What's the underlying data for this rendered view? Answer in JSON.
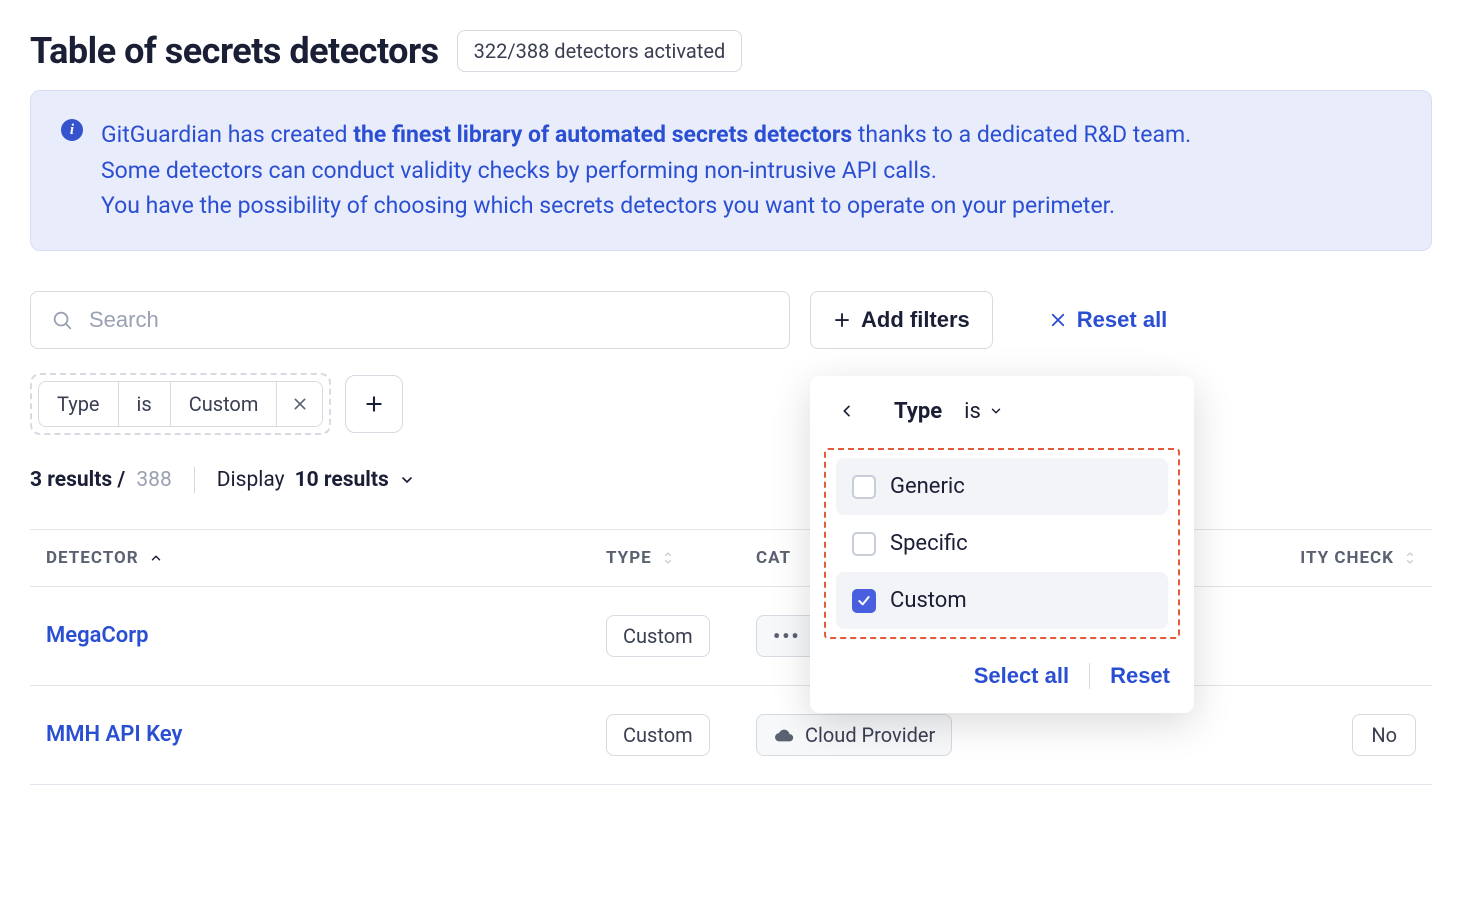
{
  "header": {
    "title": "Table of secrets detectors",
    "badge": "322/388 detectors activated"
  },
  "banner": {
    "line1_pre": "GitGuardian has created ",
    "line1_bold": "the finest library of automated secrets detectors",
    "line1_post": " thanks to a dedicated R&D team.",
    "line2": "Some detectors can conduct validity checks by performing non-intrusive API calls.",
    "line3": "You have the possibility of choosing which secrets detectors you want to operate on your perimeter."
  },
  "controls": {
    "search_placeholder": "Search",
    "add_filters": "Add filters",
    "reset_all": "Reset all"
  },
  "chips": {
    "field": "Type",
    "op": "is",
    "value": "Custom"
  },
  "meta": {
    "results_bold": "3 results /",
    "results_total": "388",
    "display_label": "Display",
    "display_value": "10 results"
  },
  "table": {
    "headers": {
      "detector": "DETECTOR",
      "type": "TYPE",
      "category": "CAT",
      "validity": "ITY CHECK"
    },
    "rows": [
      {
        "detector": "MegaCorp",
        "type": "Custom",
        "category_trunc": "…",
        "category_full": "",
        "validity": ""
      },
      {
        "detector": "MMH API Key",
        "type": "Custom",
        "category_trunc": "",
        "category_full": "Cloud Provider",
        "validity": "No"
      }
    ]
  },
  "popover": {
    "title": "Type",
    "op": "is",
    "options": [
      {
        "label": "Generic",
        "checked": false
      },
      {
        "label": "Specific",
        "checked": false
      },
      {
        "label": "Custom",
        "checked": true
      }
    ],
    "select_all": "Select all",
    "reset": "Reset"
  }
}
